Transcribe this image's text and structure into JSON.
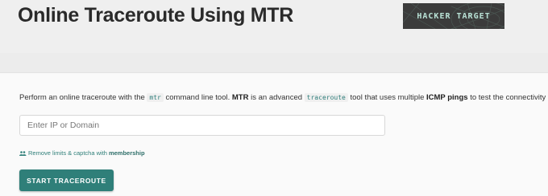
{
  "header": {
    "title": "Online Traceroute Using MTR",
    "logo_text": "HACKER TARGET"
  },
  "description": {
    "prefix": "Perform an online traceroute with the",
    "tool_code": "mtr",
    "middle1": "command line tool.",
    "bold1": "MTR",
    "middle2": "is an advanced",
    "traceroute_code": "traceroute",
    "middle3": "tool that uses multiple",
    "bold2": "ICMP pings",
    "suffix": "to test the connectivity to each hop"
  },
  "search": {
    "placeholder": "Enter IP or Domain",
    "value": ""
  },
  "promo": {
    "icon": "users-icon",
    "text": "Remove limits & captcha with",
    "link": "membership"
  },
  "actions": {
    "start_label": "START TRACEROUTE"
  },
  "colors": {
    "accent": "#2f7f79",
    "background": "#ececec",
    "card": "#fafafa",
    "logo_bg": "#3b3b3b"
  }
}
